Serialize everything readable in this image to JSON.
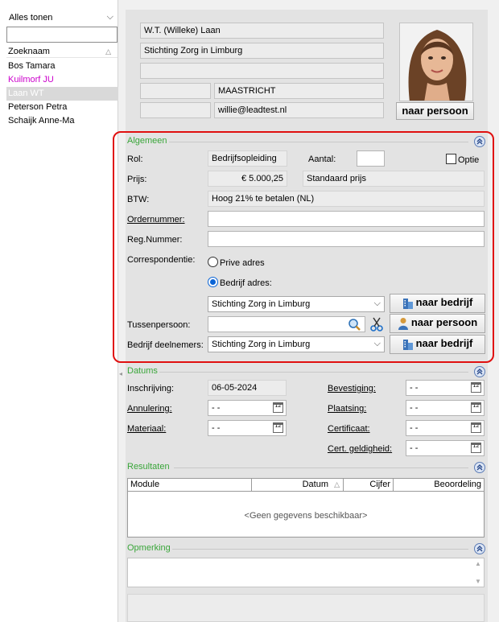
{
  "sidebar": {
    "filter": "Alles tonen",
    "search_value": "",
    "column_header": "Zoeknaam",
    "items": [
      {
        "label": "Bos Tamara"
      },
      {
        "label": "Kuilmorf JU"
      },
      {
        "label": "Laan WT"
      },
      {
        "label": "Peterson Petra"
      },
      {
        "label": "Schaijk Anne-Ma"
      }
    ]
  },
  "person": {
    "name": "W.T. (Willeke) Laan",
    "company": "Stichting Zorg in Limburg",
    "line3": "",
    "postcode": "",
    "city": "MAASTRICHT",
    "phone": "",
    "email": "willie@leadtest.nl",
    "to_person_button": "naar persoon"
  },
  "algemeen": {
    "title": "Algemeen",
    "rol_label": "Rol:",
    "rol_value": "Bedrijfsopleiding",
    "aantal_label": "Aantal:",
    "aantal_value": "",
    "optie_label": "Optie",
    "prijs_label": "Prijs:",
    "prijs_value": "€ 5.000,25",
    "prijs_type": "Standaard prijs",
    "btw_label": "BTW:",
    "btw_value": "Hoog 21% te betalen (NL)",
    "ordernummer_label": "Ordernummer:",
    "ordernummer_value": "",
    "regnummer_label": "Reg.Nummer:",
    "regnummer_value": "",
    "correspondentie_label": "Correspondentie:",
    "prive_label": "Prive adres",
    "bedrijf_adres_label": "Bedrijf adres:",
    "bedrijf_value": "Stichting Zorg in Limburg",
    "naar_bedrijf_1": "naar bedrijf",
    "tussenpersoon_label": "Tussenpersoon:",
    "tussenpersoon_value": "",
    "naar_persoon": "naar persoon",
    "deelnemers_label": "Bedrijf deelnemers:",
    "deelnemers_value": "Stichting Zorg in Limburg",
    "naar_bedrijf_2": "naar bedrijf"
  },
  "datums": {
    "title": "Datums",
    "inschrijving_label": "Inschrijving:",
    "inschrijving_value": "06-05-2024",
    "annulering_label": "Annulering:",
    "annulering_value": "- -",
    "materiaal_label": "Materiaal:",
    "materiaal_value": "- -",
    "bevestiging_label": "Bevestiging:",
    "bevestiging_value": "- -",
    "plaatsing_label": "Plaatsing:",
    "plaatsing_value": "- -",
    "certificaat_label": "Certificaat:",
    "certificaat_value": "- -",
    "geldigheid_label": "Cert. geldigheid:",
    "geldigheid_value": "- -",
    "calendar_text": "12"
  },
  "resultaten": {
    "title": "Resultaten",
    "columns": [
      "Module",
      "Datum",
      "Cijfer",
      "Beoordeling"
    ],
    "empty": "<Geen gegevens beschikbaar>"
  },
  "opmerking": {
    "title": "Opmerking",
    "value": ""
  },
  "colors": {
    "accent_green": "#3aa63a",
    "highlight_red": "#e01010",
    "radio_blue": "#0a64d6",
    "magenta": "#cc00cc"
  },
  "icons": [
    "chevron-down-icon",
    "collapse-up-icon",
    "company-icon",
    "person-icon",
    "search-icon",
    "scissors-icon",
    "calendar-icon",
    "sort-asc-icon"
  ]
}
